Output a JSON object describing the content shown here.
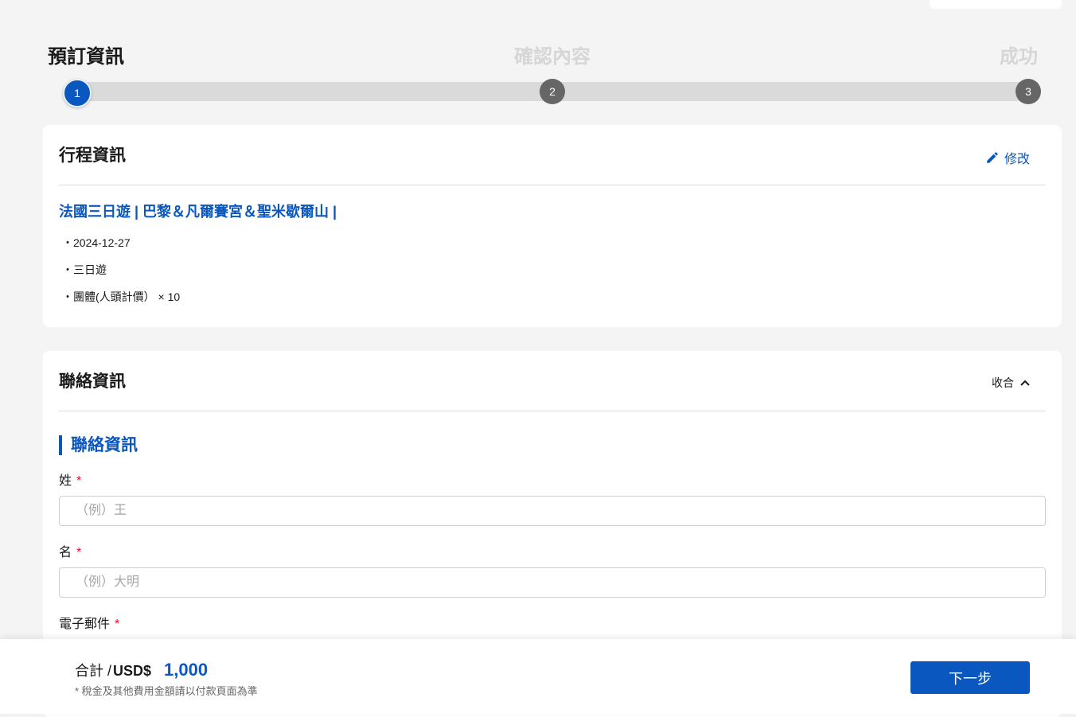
{
  "stepper": {
    "steps": [
      {
        "label": "預訂資訊",
        "number": "1",
        "state": "active"
      },
      {
        "label": "確認內容",
        "number": "2",
        "state": "pending"
      },
      {
        "label": "成功",
        "number": "3",
        "state": "pending"
      }
    ]
  },
  "trip": {
    "title": "行程資訊",
    "edit_label": "修改",
    "edit_icon": "pencil-icon",
    "name": "法國三日遊 | 巴黎＆凡爾賽宮＆聖米歇爾山 |",
    "details": [
      "2024-12-27",
      "三日遊",
      "團體(人頭計價） × 10"
    ]
  },
  "contact": {
    "title": "聯絡資訊",
    "collapse_label": "收合",
    "collapse_icon": "chevron-up-icon",
    "section_title": "聯絡資訊",
    "required_mark": "*",
    "fields": [
      {
        "label": "姓",
        "placeholder": "（例）王",
        "value": ""
      },
      {
        "label": "名",
        "placeholder": "（例）大明",
        "value": ""
      },
      {
        "label": "電子郵件"
      }
    ]
  },
  "footer": {
    "total_label": "合計 /",
    "currency": "USD$",
    "amount": "1,000",
    "note": "* 稅金及其他費用金額請以付款頁面為準",
    "next_label": "下一步"
  },
  "colors": {
    "accent": "#0a57bf",
    "required": "#e0102a",
    "step_inactive": "#666666"
  }
}
